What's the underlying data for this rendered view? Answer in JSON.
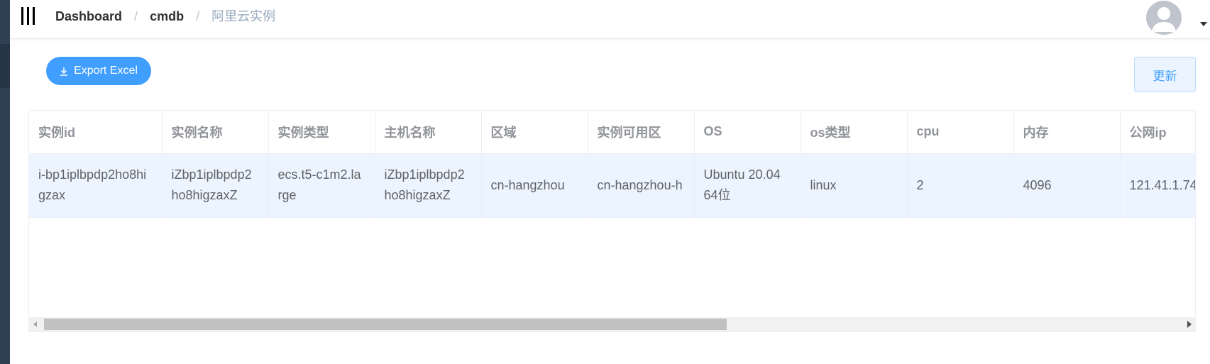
{
  "breadcrumb": {
    "items": [
      "Dashboard",
      "cmdb",
      "阿里云实例"
    ],
    "separator": "/"
  },
  "toolbar": {
    "export_label": "Export Excel",
    "refresh_label": "更新"
  },
  "table": {
    "headers": [
      "实例id",
      "实例名称",
      "实例类型",
      "主机名称",
      "区域",
      "实例可用区",
      "OS",
      "os类型",
      "cpu",
      "内存",
      "公网ip"
    ],
    "rows": [
      [
        "i-bp1iplbpdp2ho8higzax",
        "iZbp1iplbpdp2ho8higzaxZ",
        "ecs.t5-c1m2.large",
        "iZbp1iplbpdp2ho8higzaxZ",
        "cn-hangzhou",
        "cn-hangzhou-h",
        "Ubuntu 20.04 64位",
        "linux",
        "2",
        "4096",
        "121.41.1.74"
      ]
    ]
  },
  "colors": {
    "primary": "#409eff",
    "sidebar": "#304156",
    "row_highlight": "#ecf5ff"
  },
  "icons": [
    "hamburger-icon",
    "download-icon",
    "user-avatar-icon",
    "caret-down-icon"
  ]
}
